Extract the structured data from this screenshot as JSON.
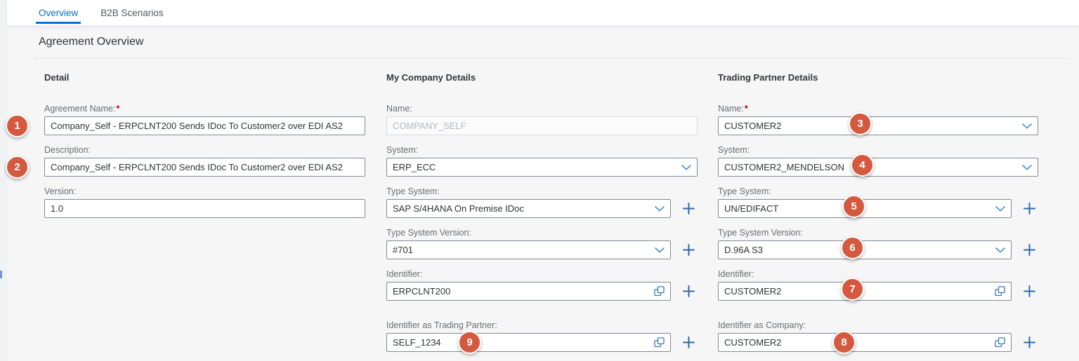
{
  "tabs": [
    {
      "label": "Overview",
      "active": true
    },
    {
      "label": "B2B Scenarios",
      "active": false
    }
  ],
  "page": {
    "title": "Agreement Overview"
  },
  "columns": {
    "detail": {
      "heading": "Detail",
      "fields": [
        {
          "label": "Agreement Name:",
          "required": "*",
          "value": "Company_Self - ERPCLNT200 Sends IDoc To Customer2 over EDI AS2",
          "badge": "1"
        },
        {
          "label": "Description:",
          "value": "Company_Self - ERPCLNT200 Sends IDoc To Customer2 over EDI AS2",
          "badge": "2"
        },
        {
          "label": "Version:",
          "value": "1.0"
        }
      ]
    },
    "company": {
      "heading": "My Company Details",
      "fields": [
        {
          "label": "Name:",
          "value": "COMPANY_SELF",
          "disabled": true
        },
        {
          "label": "System:",
          "value": "ERP_ECC"
        },
        {
          "label": "Type System:",
          "value": "SAP S/4HANA On Premise IDoc"
        },
        {
          "label": "Type System Version:",
          "value": "#701"
        },
        {
          "label": "Identifier:",
          "value": "ERPCLNT200"
        },
        {
          "label": "Identifier as Trading Partner:",
          "value": "SELF_1234",
          "badge": "9"
        }
      ]
    },
    "partner": {
      "heading": "Trading Partner Details",
      "fields": [
        {
          "label": "Name:",
          "required": "*",
          "value": "CUSTOMER2",
          "badge": "3"
        },
        {
          "label": "System:",
          "value": "CUSTOMER2_MENDELSON",
          "badge": "4"
        },
        {
          "label": "Type System:",
          "value": "UN/EDIFACT",
          "badge": "5"
        },
        {
          "label": "Type System Version:",
          "value": "D.96A S3",
          "badge": "6"
        },
        {
          "label": "Identifier:",
          "value": "CUSTOMER2",
          "badge": "7"
        },
        {
          "label": "Identifier as Company:",
          "value": "CUSTOMER2",
          "badge": "8"
        }
      ]
    }
  },
  "icons": {
    "chevron-down-icon": "∨",
    "copy-icon": "⧉",
    "plus-icon": "+"
  },
  "colors": {
    "accent_blue": "#0a6ed1",
    "icon_blue": "#3a77bd",
    "badge_orange": "#d4593f",
    "label_gray": "#6a6d70",
    "border_gray": "#848a90",
    "required_red": "#c3000a"
  }
}
